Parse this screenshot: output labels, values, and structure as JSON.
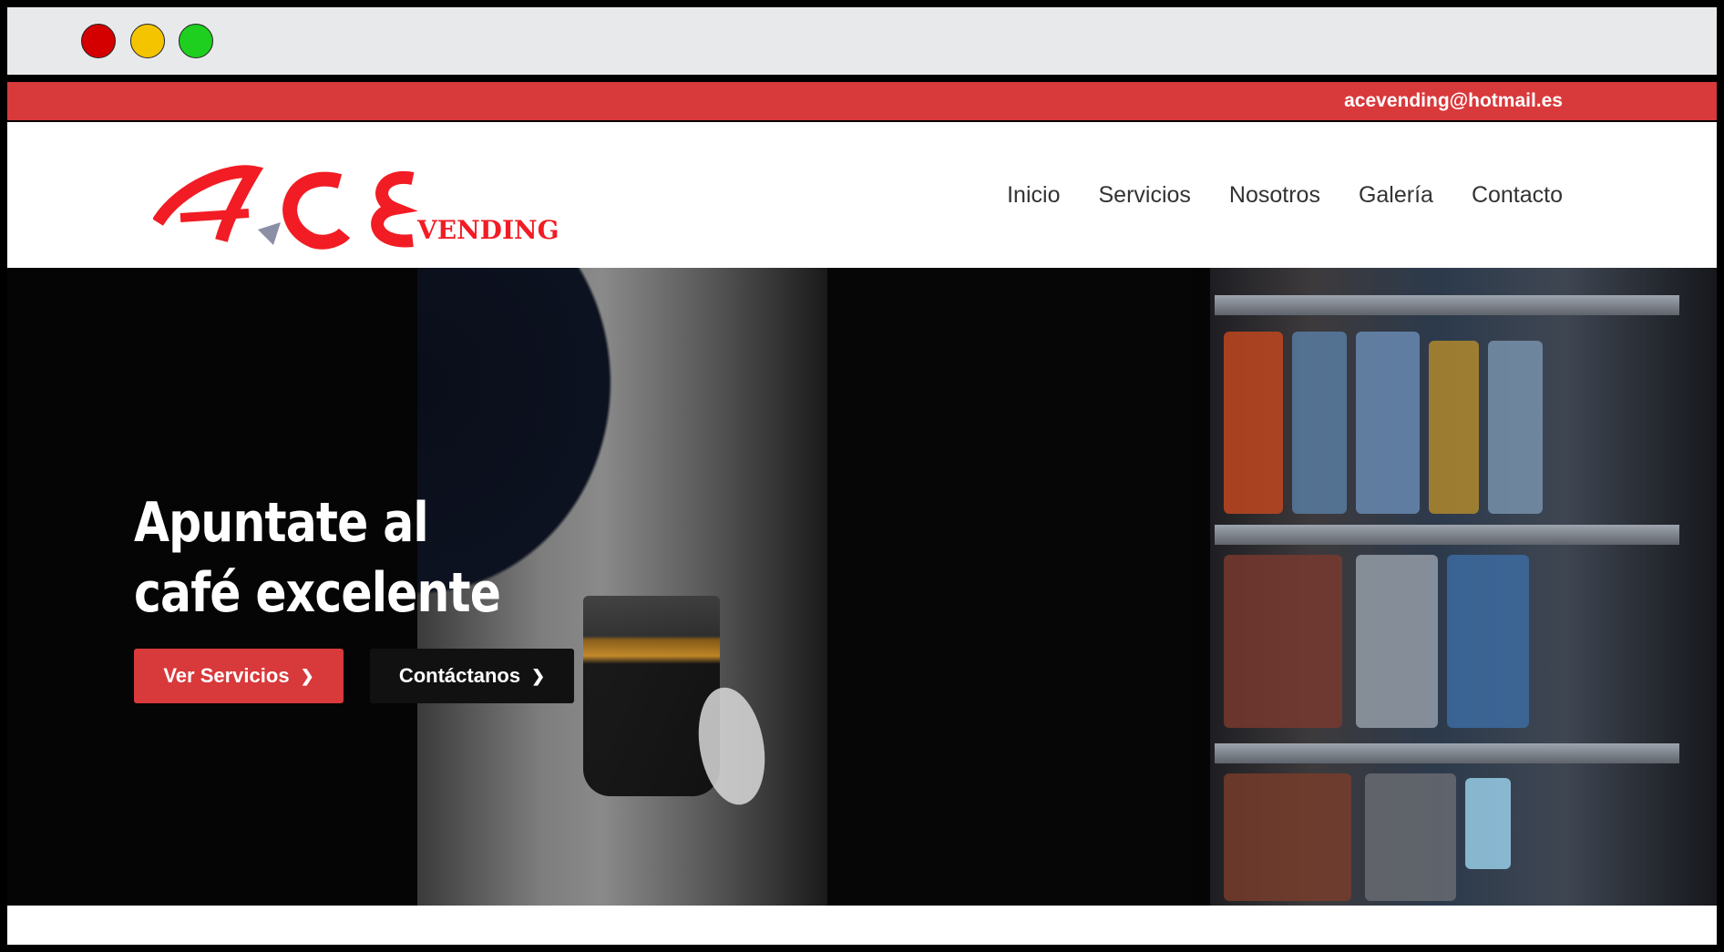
{
  "topbar": {
    "email": "acevending@hotmail.es"
  },
  "logo": {
    "main": "ACE",
    "sub": "VENDING"
  },
  "nav": {
    "items": [
      "Inicio",
      "Servicios",
      "Nosotros",
      "Galería",
      "Contacto"
    ]
  },
  "hero": {
    "title_line1": "Apuntate al",
    "title_line2": "café excelente",
    "primary_button": "Ver Servicios",
    "secondary_button": "Contáctanos"
  },
  "colors": {
    "accent": "#d8393b",
    "dark": "#111111"
  }
}
